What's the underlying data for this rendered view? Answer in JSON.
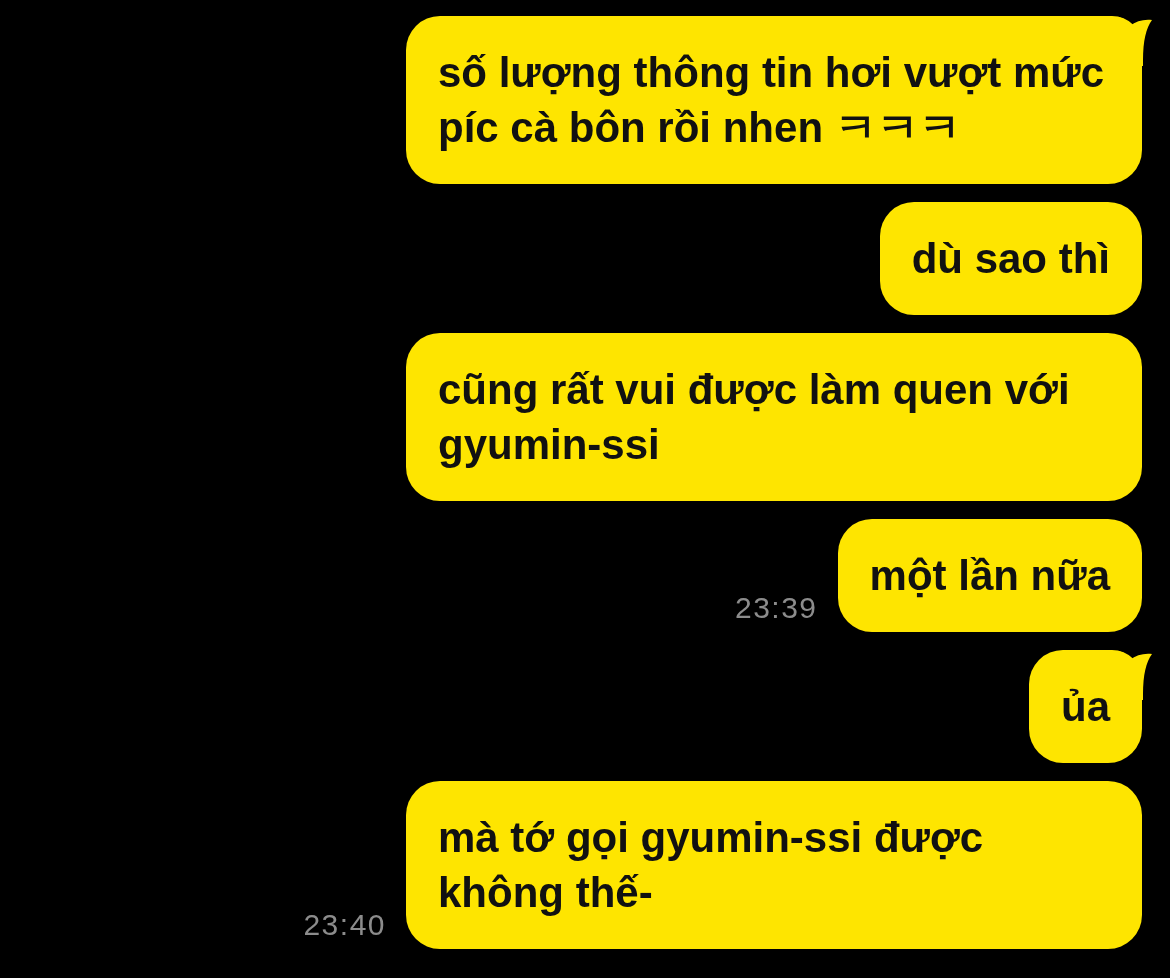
{
  "messages": [
    {
      "text": "số lượng thông tin hơi vượt mức píc cà bôn rồi nhen ㅋㅋㅋ",
      "tail": true
    },
    {
      "text": "dù sao thì",
      "tail": false
    },
    {
      "text": "cũng rất vui được làm quen với gyumin-ssi",
      "tail": false
    },
    {
      "text": "một lần nữa",
      "tail": false,
      "time": "23:39"
    },
    {
      "text": "ủa",
      "tail": true
    },
    {
      "text": "mà tớ gọi gyumin-ssi được không thế-",
      "tail": false,
      "time": "23:40"
    }
  ]
}
